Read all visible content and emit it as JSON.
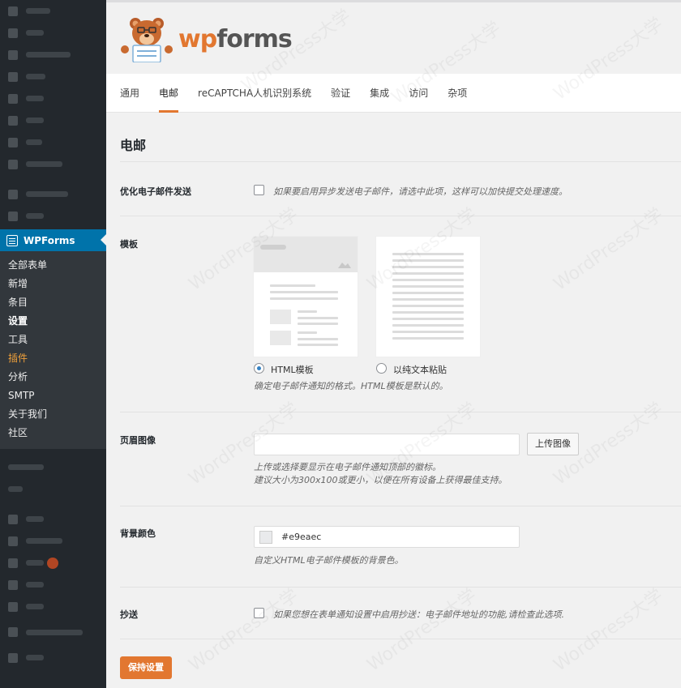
{
  "sidebar": {
    "active_menu": "WPForms",
    "submenu": [
      {
        "label": "全部表单",
        "state": "normal"
      },
      {
        "label": "新增",
        "state": "normal"
      },
      {
        "label": "条目",
        "state": "normal"
      },
      {
        "label": "设置",
        "state": "current"
      },
      {
        "label": "工具",
        "state": "normal"
      },
      {
        "label": "插件",
        "state": "highlight"
      },
      {
        "label": "分析",
        "state": "normal"
      },
      {
        "label": "SMTP",
        "state": "normal"
      },
      {
        "label": "关于我们",
        "state": "normal"
      },
      {
        "label": "社区",
        "state": "normal"
      }
    ]
  },
  "header": {
    "logo_wp": "wp",
    "logo_forms": "forms"
  },
  "tabs": [
    {
      "label": "通用",
      "active": false
    },
    {
      "label": "电邮",
      "active": true
    },
    {
      "label": "reCAPTCHA人机识别系统",
      "active": false
    },
    {
      "label": "验证",
      "active": false
    },
    {
      "label": "集成",
      "active": false
    },
    {
      "label": "访问",
      "active": false
    },
    {
      "label": "杂项",
      "active": false
    }
  ],
  "main": {
    "section_title": "电邮",
    "async": {
      "label": "优化电子邮件发送",
      "desc": "如果要启用异步发送电子邮件，请选中此项，这样可以加快提交处理速度。"
    },
    "template": {
      "label": "模板",
      "option_html": "HTML模板",
      "option_plain": "以纯文本粘贴",
      "desc": "确定电子邮件通知的格式。HTML模板是默认的。"
    },
    "header_image": {
      "label": "页眉图像",
      "upload_label": "上传图像",
      "desc_line1": "上传或选择要显示在电子邮件通知顶部的徽标。",
      "desc_line2": "建议大小为300x100或更小，以便在所有设备上获得最佳支持。"
    },
    "background_color": {
      "label": "背景颜色",
      "value": "#e9eaec",
      "desc": "自定义HTML电子邮件模板的背景色。"
    },
    "cc": {
      "label": "抄送",
      "desc": "如果您想在表单通知设置中启用抄送：电子邮件地址的功能,请检查此选项."
    },
    "save_label": "保持设置"
  },
  "colors": {
    "accent": "#e27730",
    "wp_blue": "#0073aa",
    "sidebar_bg": "#23282d"
  }
}
